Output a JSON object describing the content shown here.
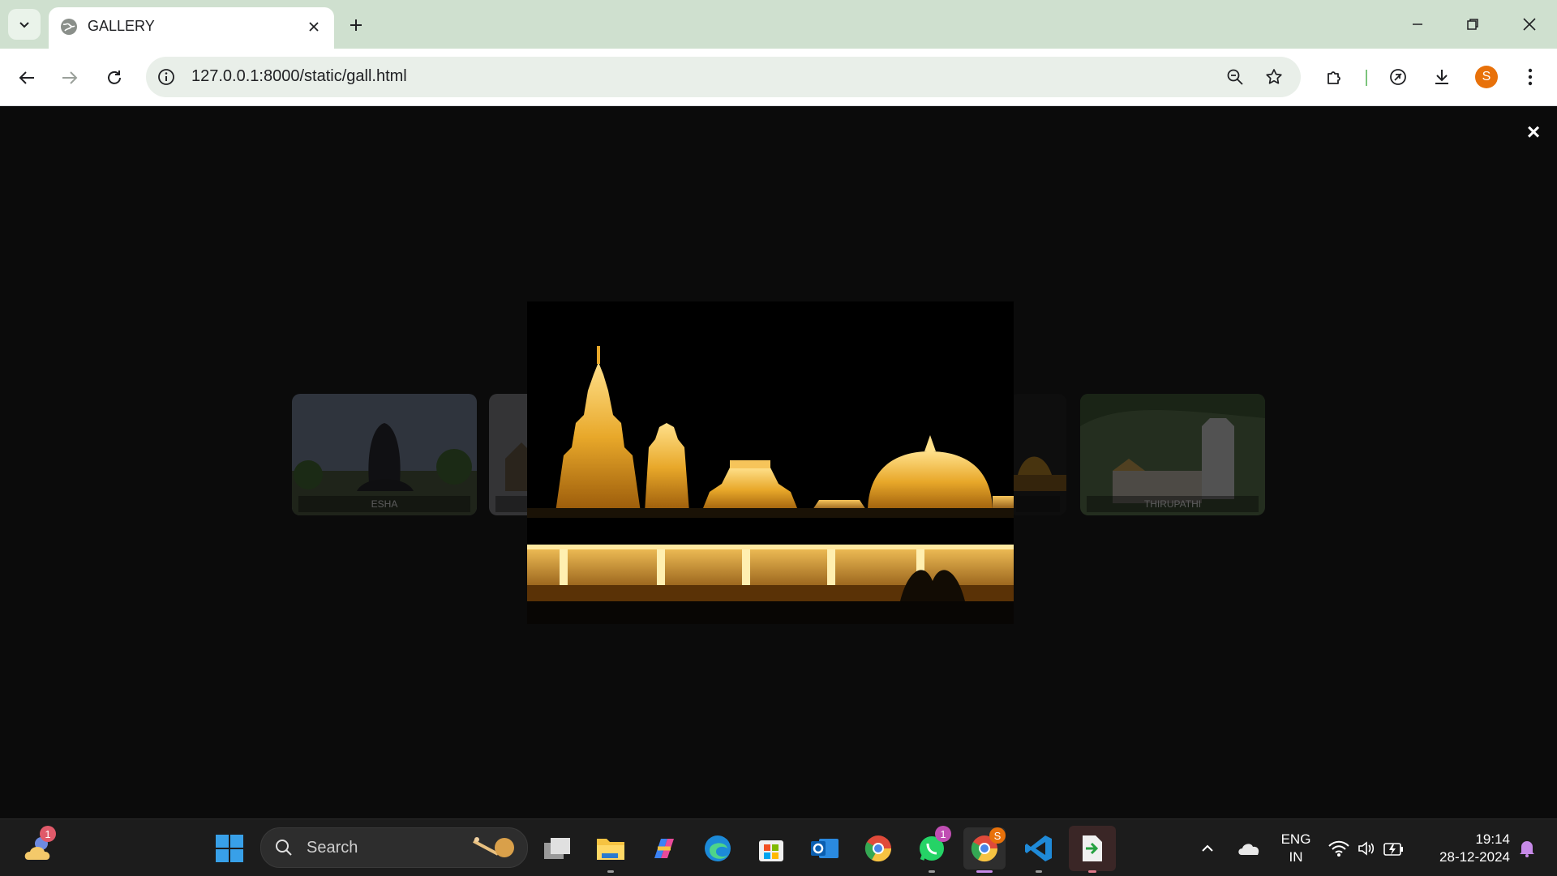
{
  "browser": {
    "tab_title": "GALLERY",
    "url": "127.0.0.1:8000/static/gall.html",
    "profile_initial": "S"
  },
  "gallery": {
    "close_symbol": "×",
    "thumbnails": [
      {
        "label": "ESHA"
      },
      {
        "label": ""
      },
      {
        "label": ""
      },
      {
        "label": "THIRUPATHI"
      }
    ]
  },
  "taskbar": {
    "search_label": "Search",
    "weather_badge": "1",
    "whatsapp_badge": "1",
    "chrome_profile_badge": "S",
    "language_line1": "ENG",
    "language_line2": "IN",
    "time": "19:14",
    "date": "28-12-2024"
  },
  "colors": {
    "tab_bar": "#cfe0cf",
    "omnibox": "#e9efe9",
    "page_bg": "#0b0b0b",
    "taskbar_bg": "#1c1c1c",
    "profile": "#e8710a",
    "gold": "#e8a82a"
  }
}
